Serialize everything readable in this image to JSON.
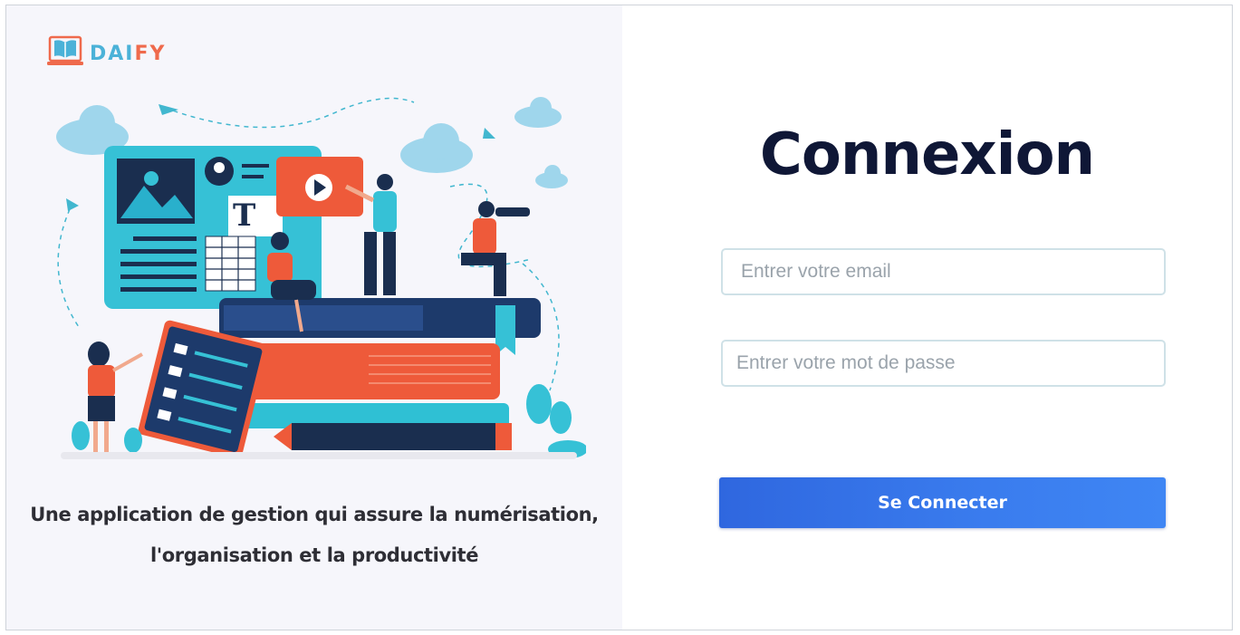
{
  "brand": {
    "name_part1": "DAI",
    "name_part2": "FY"
  },
  "left": {
    "tagline_line1": "Une application de gestion qui assure la numérisation,",
    "tagline_line2": "l'organisation et la productivité"
  },
  "login": {
    "title": "Connexion",
    "email_placeholder": "Entrer votre email",
    "password_placeholder": "Entrer votre mot de passe",
    "submit_label": "Se Connecter"
  },
  "colors": {
    "brand_blue": "#4bb2d8",
    "brand_orange": "#ef6a4c",
    "title_navy": "#0f1736",
    "button_blue": "#3a7cee",
    "left_panel_bg": "#f6f6fb"
  },
  "icons": [
    "book-laptop-logo-icon",
    "illustration-image"
  ]
}
